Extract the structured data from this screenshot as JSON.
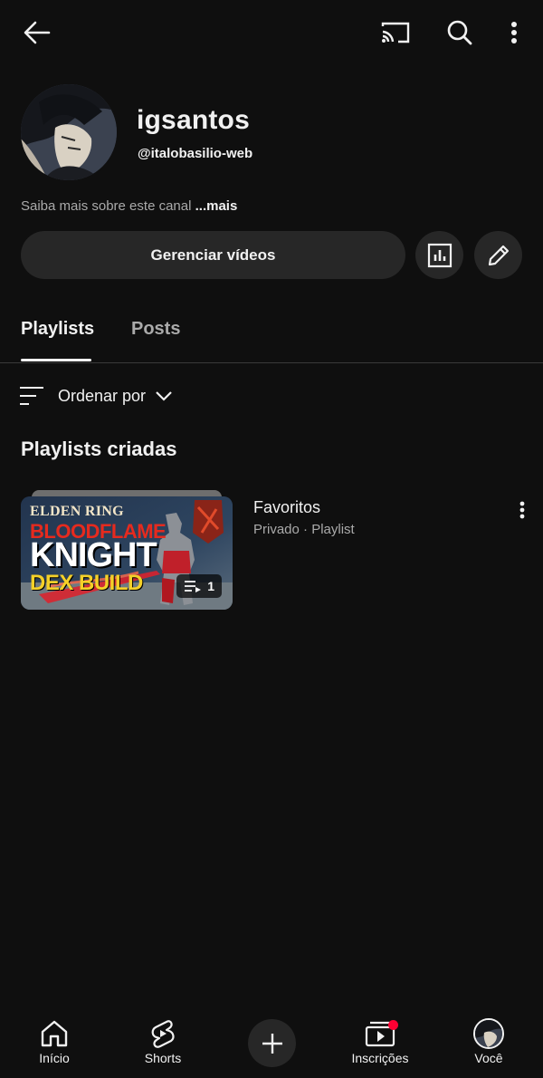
{
  "top_bar": {
    "back_icon": "arrow-left-icon",
    "cast_icon": "cast-icon",
    "search_icon": "search-icon",
    "menu_icon": "more-vertical-icon"
  },
  "channel": {
    "name": "igsantos",
    "handle": "@italobasilio-web",
    "about_text": "Saiba mais sobre este canal",
    "about_more": "...mais"
  },
  "actions": {
    "manage_videos_label": "Gerenciar vídeos",
    "analytics_icon": "analytics-icon",
    "edit_icon": "pencil-icon"
  },
  "tabs": [
    {
      "label": "Playlists",
      "active": true
    },
    {
      "label": "Posts",
      "active": false
    }
  ],
  "sort": {
    "label": "Ordenar por",
    "icon": "sort-lines-icon",
    "chevron": "chevron-down-icon"
  },
  "section": {
    "title": "Playlists criadas"
  },
  "playlists": [
    {
      "title": "Favoritos",
      "meta": "Privado · Playlist",
      "video_count": "1",
      "thumbnail_text": {
        "line1": "ELDEN RING",
        "line2": "BLOODFLAME",
        "line3": "KNIGHT",
        "line4": "DEX BUILD"
      }
    }
  ],
  "bottom_nav": [
    {
      "label": "Início",
      "icon": "home-icon"
    },
    {
      "label": "Shorts",
      "icon": "shorts-icon"
    },
    {
      "label": "",
      "icon": "plus-icon"
    },
    {
      "label": "Inscrições",
      "icon": "subscriptions-icon"
    },
    {
      "label": "Você",
      "icon": "avatar-icon"
    }
  ],
  "colors": {
    "background": "#0f0f0f",
    "surface": "#272727",
    "text_primary": "#f1f1f1",
    "text_secondary": "#aaaaaa",
    "notification": "#ff0033"
  }
}
